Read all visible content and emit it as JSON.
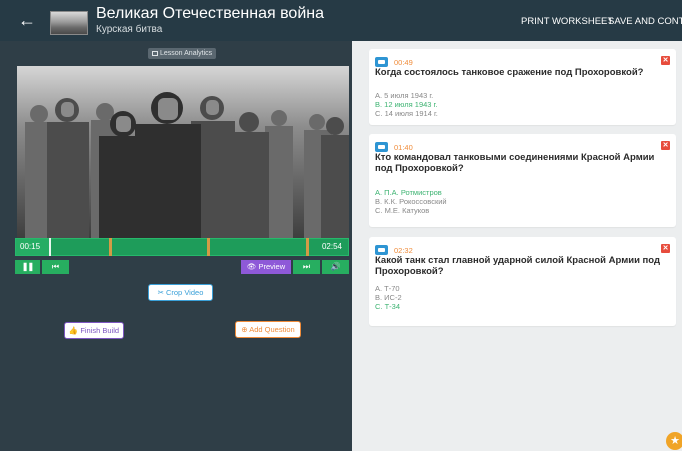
{
  "header": {
    "title": "Великая Отечественная война",
    "subtitle": "Курская битва",
    "back_icon": "←",
    "print_label": "PRINT WORKSHEET",
    "save_label": "SAVE AND CONTINUE"
  },
  "player": {
    "analytics_label": "Lesson Analytics",
    "current_time": "00:15",
    "duration": "02:54",
    "progress_fraction": 0.1,
    "markers": [
      "00:49",
      "01:40",
      "02:32"
    ],
    "preview_label": "👁 Preview",
    "pause_icon": "❚❚",
    "rewind_icon": "⏮",
    "forward_icon": "⏭",
    "volume_icon": "🔊",
    "crop_label": "✂ Crop Video",
    "finish_label": "👍 Finish Build",
    "add_label": "⊕ Add Question"
  },
  "questions": [
    {
      "time": "00:49",
      "text": "Когда состоялось танковое сражение под Прохоровкой?",
      "options": [
        "A. 5 июля 1943 г.",
        "B. 12 июля 1943 г.",
        "C. 14 июля 1914 г."
      ],
      "correct": 1
    },
    {
      "time": "01:40",
      "text": "Кто командовал танковыми соединениями Красной Армии под Прохоровкой?",
      "options": [
        "A. П.А. Ротмистров",
        "B. К.К. Рокоссовский",
        "C. М.Е. Катуков"
      ],
      "correct": 0
    },
    {
      "time": "02:32",
      "text": "Какой танк стал главной ударной силой Красной Армии под Прохоровкой?",
      "options": [
        "A. Т-70",
        "B. ИС-2",
        "C. Т-34"
      ],
      "correct": 2
    }
  ],
  "colors": {
    "topbar": "#263a45",
    "accent_green": "#27ae60",
    "marker_orange": "#d39b46",
    "correct_green": "#3cb371",
    "delete_red": "#e74c3c"
  }
}
